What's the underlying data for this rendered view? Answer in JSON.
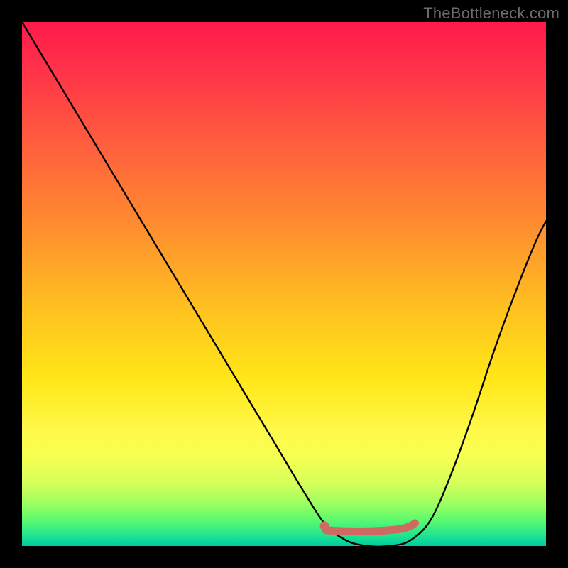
{
  "watermark": "TheBottleneck.com",
  "colors": {
    "background": "#000000",
    "curve_stroke": "#000000",
    "marker_fill": "#cf6a61",
    "marker_stroke": "#cf6a61"
  },
  "chart_data": {
    "type": "line",
    "title": "",
    "xlabel": "",
    "ylabel": "",
    "xlim": [
      0,
      100
    ],
    "ylim": [
      0,
      100
    ],
    "grid": false,
    "series": [
      {
        "name": "bottleneck-curve",
        "x": [
          0,
          6,
          12,
          18,
          24,
          30,
          36,
          42,
          48,
          54,
          58,
          62,
          66,
          70,
          74,
          78,
          82,
          86,
          90,
          94,
          98,
          100
        ],
        "values": [
          100,
          90,
          80,
          70,
          60,
          50,
          40,
          30,
          20,
          10,
          4,
          1,
          0,
          0,
          1,
          5,
          14,
          25,
          37,
          48,
          58,
          62
        ]
      }
    ],
    "flat_region": {
      "name": "optimal-range-marker",
      "x_start": 58,
      "x_end": 75,
      "y": 3
    },
    "annotations": []
  }
}
